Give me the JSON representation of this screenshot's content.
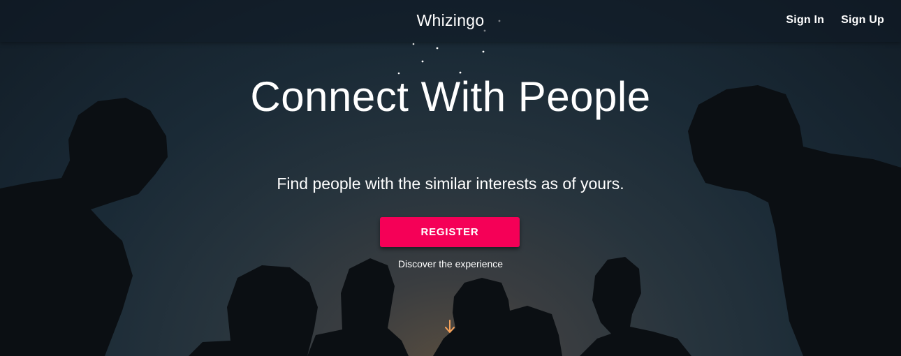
{
  "header": {
    "brand": "Whizingo",
    "nav": {
      "sign_in": "Sign In",
      "sign_up": "Sign Up"
    }
  },
  "hero": {
    "headline": "Connect With People",
    "tagline": "Find people with the similar interests as of yours.",
    "register_label": "REGISTER",
    "discover_text": "Discover the experience",
    "scroll_icon": "arrow-down-icon"
  },
  "colors": {
    "accent": "#f50057",
    "arrow": "#f5a15a",
    "text": "#ffffff",
    "sky_dark": "#121d27"
  }
}
